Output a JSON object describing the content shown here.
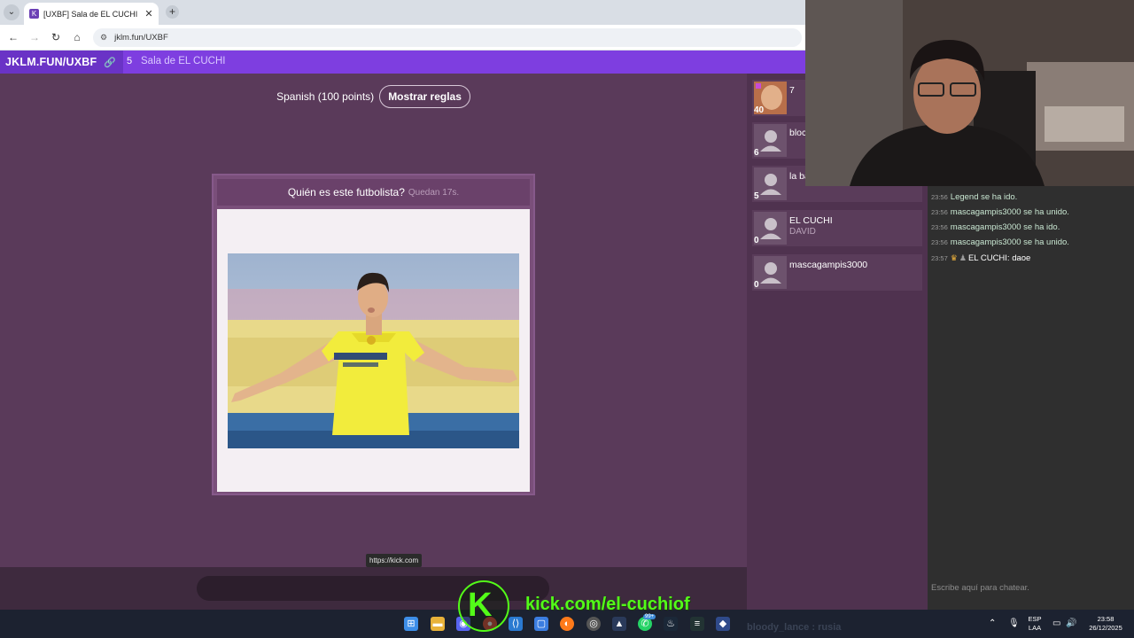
{
  "browser": {
    "tab_title": "[UXBF] Sala de EL CUCHI",
    "url": "jklm.fun/UXBF",
    "tooltip": "https://kick.com"
  },
  "site": {
    "brand": "JKLM.FUN/UXBF",
    "room_count": "5",
    "room_title": "Sala de EL CUCHI"
  },
  "game": {
    "rules_text": "Spanish (100 points)",
    "rules_button": "Mostrar reglas",
    "question": "Quién es este futbolista?",
    "timer": "Quedan 17s."
  },
  "players": [
    {
      "name": "7",
      "score": "40",
      "sub": ""
    },
    {
      "name": "bloc",
      "score": "6",
      "sub": ""
    },
    {
      "name": "la ba",
      "score": "5",
      "sub": ""
    },
    {
      "name": "EL CUCHI",
      "score": "0",
      "sub": "DAVID"
    },
    {
      "name": "mascagampis3000",
      "score": "0",
      "sub": ""
    }
  ],
  "chat": {
    "lines": [
      {
        "time": "23:56",
        "text": "Legend se ha ido."
      },
      {
        "time": "23:56",
        "text": "mascagampis3000 se ha unido."
      },
      {
        "time": "23:56",
        "text": "mascagampis3000 se ha ido."
      },
      {
        "time": "23:56",
        "text": "mascagampis3000 se ha unido."
      },
      {
        "time": "23:57",
        "text": "EL CUCHI: daoe"
      }
    ],
    "placeholder": "Escribe aquí para chatear."
  },
  "taskbar": {
    "lang_1": "ESP",
    "lang_2": "LAA",
    "time": "23:58",
    "date": "26/12/2025",
    "badge": "99+"
  },
  "overlay": {
    "kick_letter": "K",
    "kick_url": "kick.com/el-cuchiof",
    "ghost_text": "bloody_lance : rusia"
  },
  "colors": {
    "site_header": "#7e3ee0",
    "game_bg": "#5a3a5a",
    "kick_green": "#53fc18"
  }
}
